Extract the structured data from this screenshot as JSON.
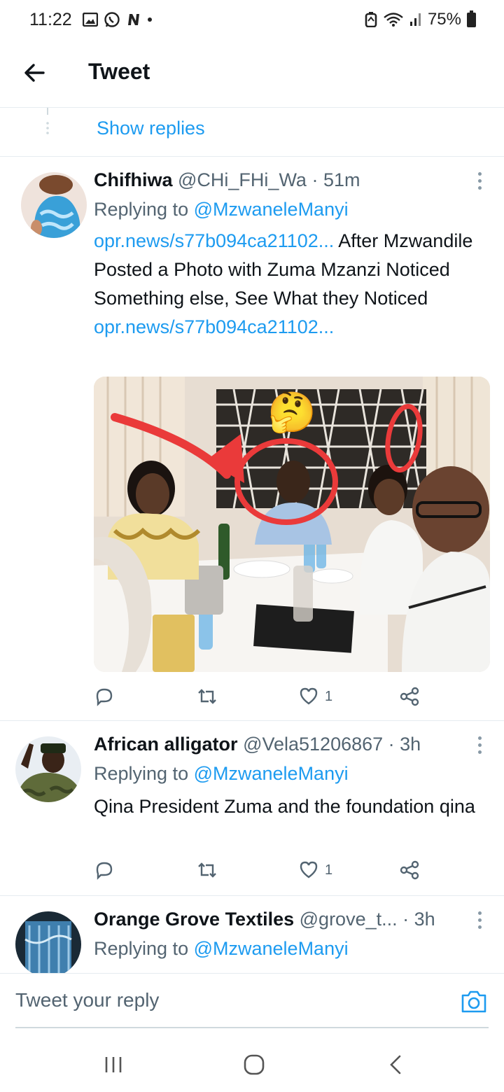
{
  "status": {
    "time": "11:22",
    "battery": "75%"
  },
  "header": {
    "title": "Tweet"
  },
  "thread": {
    "show_replies": "Show replies"
  },
  "tweets": [
    {
      "name": "Chifhiwa",
      "handle": "@CHi_FHi_Wa",
      "time": "· 51m",
      "replying_prefix": "Replying to",
      "replying_to": "@MzwaneleManyi",
      "link1": "opr.news/s77b094ca21102...",
      "text": "After Mzwandile Posted a Photo with Zuma Mzanzi Noticed Something else, See What they Noticed",
      "link2": "opr.news/s77b094ca21102...",
      "likes": "1",
      "media_emoji": "🤔"
    },
    {
      "name": "African alligator",
      "handle": "@Vela51206867",
      "time": "· 3h",
      "replying_prefix": "Replying to",
      "replying_to": "@MzwaneleManyi",
      "text": "Qina President Zuma and the foundation qina",
      "likes": "1"
    },
    {
      "name": "Orange Grove Textiles",
      "handle": "@grove_t...",
      "time": "· 3h",
      "replying_prefix": "Replying to",
      "replying_to": "@MzwaneleManyi"
    }
  ],
  "composer": {
    "placeholder": "Tweet your reply"
  },
  "colors": {
    "accent": "#1d9bf0",
    "muted": "#536471",
    "text": "#0f1419"
  }
}
